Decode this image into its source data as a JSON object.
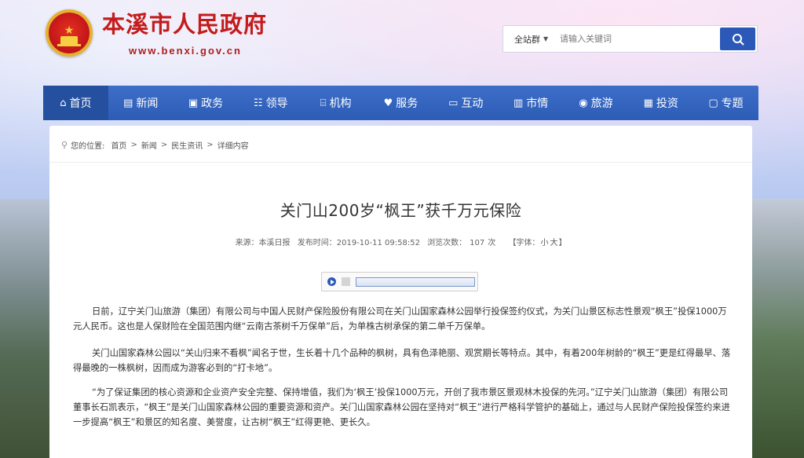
{
  "header": {
    "site_name": "本溪市人民政府",
    "site_url": "www.benxi.gov.cn"
  },
  "search": {
    "scope": "全站群",
    "placeholder": "请输入关键词"
  },
  "nav": [
    {
      "label": "首页",
      "icon": "home-icon"
    },
    {
      "label": "新闻",
      "icon": "news-icon"
    },
    {
      "label": "政务",
      "icon": "affairs-icon"
    },
    {
      "label": "领导",
      "icon": "leader-icon"
    },
    {
      "label": "机构",
      "icon": "institution-icon"
    },
    {
      "label": "服务",
      "icon": "service-icon"
    },
    {
      "label": "互动",
      "icon": "interaction-icon"
    },
    {
      "label": "市情",
      "icon": "city-icon"
    },
    {
      "label": "旅游",
      "icon": "tourism-icon"
    },
    {
      "label": "投资",
      "icon": "investment-icon"
    },
    {
      "label": "专题",
      "icon": "topic-icon"
    }
  ],
  "breadcrumb": {
    "prefix": "您的位置:",
    "items": [
      "首页",
      "新闻",
      "民生资讯",
      "详细内容"
    ]
  },
  "article": {
    "title": "关门山200岁“枫王”获千万元保险",
    "source_label": "来源：本溪日报",
    "time_label": "发布时间：2019-10-11 09:58:52",
    "views_label": "浏览次数：",
    "views_value": "107",
    "views_unit": "次",
    "fontsize_label": "【字体：",
    "fontsize_small": "小",
    "fontsize_large": "大",
    "fontsize_end": "】",
    "paragraphs": [
      "日前，辽宁关门山旅游（集团）有限公司与中国人民财产保险股份有限公司在关门山国家森林公园举行投保签约仪式，为关门山景区标志性景观“枫王”投保1000万元人民币。这也是人保财险在全国范围内继“云南古茶树千万保单”后，为单株古树承保的第二单千万保单。",
      "关门山国家森林公园以“关山归来不看枫”闻名于世，生长着十几个品种的枫树，具有色泽艳丽、观赏期长等特点。其中，有着200年树龄的“枫王”更是红得最早、落得最晚的一株枫树，因而成为游客必到的“打卡地”。",
      "“为了保证集团的核心资源和企业资产安全完整、保持增值，我们为‘枫王’投保1000万元，开创了我市景区景观林木投保的先河。”辽宁关门山旅游（集团）有限公司董事长石凯表示，“枫王”是关门山国家森林公园的重要资源和资产。关门山国家森林公园在坚持对“枫王”进行严格科学管护的基础上，通过与人民财产保险投保签约来进一步提高“枫王”和景区的知名度、美誉度，让古树“枫王”红得更艳、更长久。"
    ]
  },
  "colors": {
    "nav_bg": "#2c5cb6",
    "title_red": "#c41b1b",
    "search_button": "#2c58b8"
  }
}
